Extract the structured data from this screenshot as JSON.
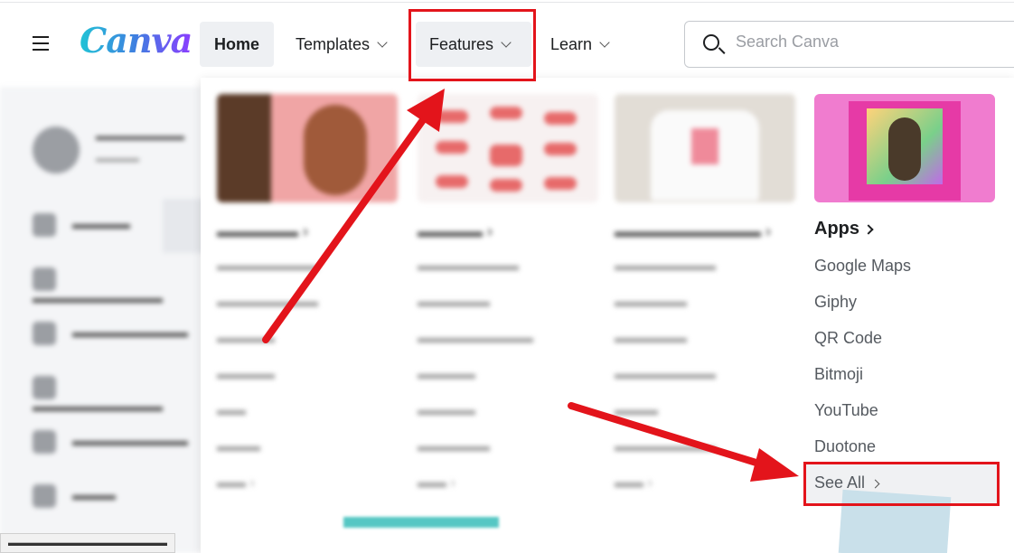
{
  "header": {
    "logo": "Canva",
    "nav": {
      "home": "Home",
      "templates": "Templates",
      "features": "Features",
      "learn": "Learn"
    },
    "search": {
      "placeholder": "Search Canva"
    }
  },
  "features_menu": {
    "apps": {
      "title": "Apps",
      "items": [
        "Google Maps",
        "Giphy",
        "QR Code",
        "Bitmoji",
        "YouTube",
        "Duotone"
      ],
      "see_all": "See All"
    }
  },
  "annotation_color": "#e3141b",
  "icons": [
    "hamburger-menu-icon",
    "search-icon",
    "chevron-down-icon",
    "chevron-right-icon"
  ]
}
